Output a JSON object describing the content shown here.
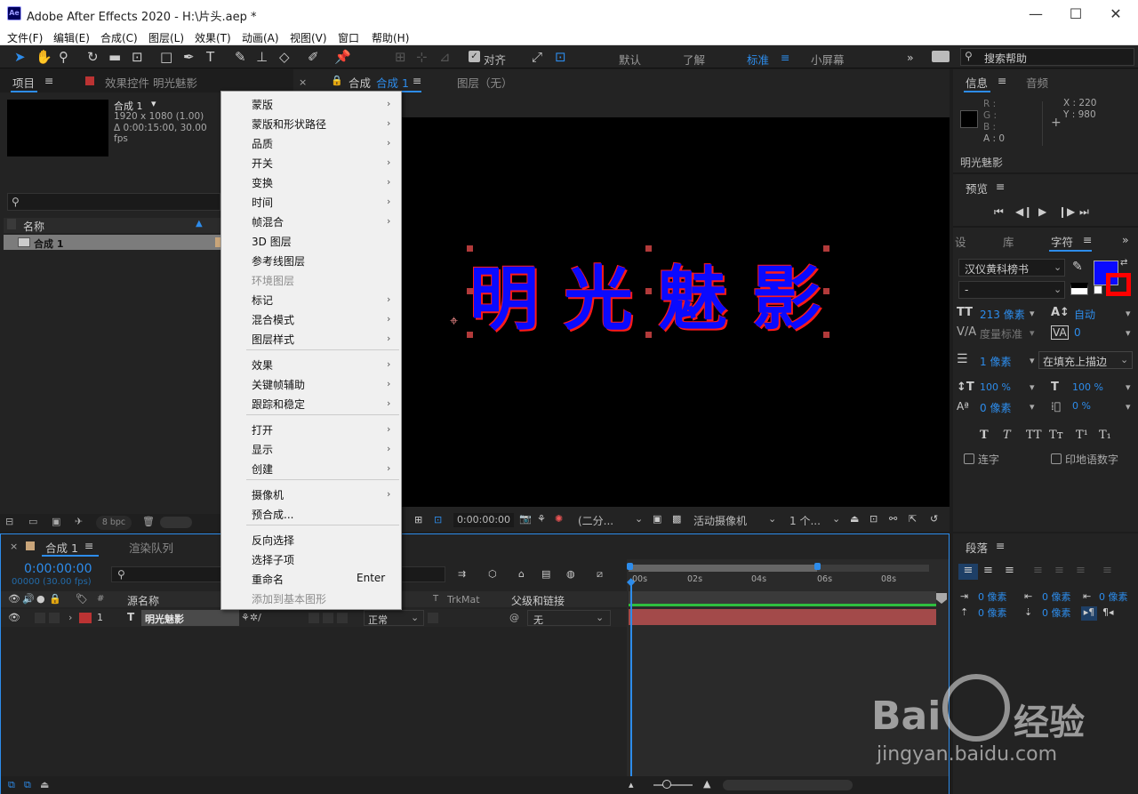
{
  "window": {
    "title": "Adobe After Effects 2020 - H:\\片头.aep *",
    "icon": "Ae"
  },
  "menu": [
    "文件(F)",
    "编辑(E)",
    "合成(C)",
    "图层(L)",
    "效果(T)",
    "动画(A)",
    "视图(V)",
    "窗口",
    "帮助(H)"
  ],
  "toolbar": {
    "align_label": "对齐",
    "workspaces": [
      "默认",
      "了解",
      "标准",
      "小屏幕"
    ],
    "active_workspace": "标准",
    "search_placeholder": "搜索帮助"
  },
  "project_panel": {
    "tab_project": "项目",
    "tab_effects": "效果控件 明光魅影",
    "comp_name": "合成 1",
    "comp_res": "1920 x 1080 (1.00)",
    "comp_dur": "Δ 0:00:15:00, 30.00 fps",
    "col_name": "名称",
    "item": "合成 1",
    "bpc": "8 bpc"
  },
  "comp_panel": {
    "tab_comp": "合成",
    "tab_comp_name": "合成 1",
    "tab_layer": "图层（无）",
    "text": "明光魅影",
    "timecode": "0:00:00:00",
    "resolution": "(二分...",
    "camera": "活动摄像机",
    "views": "1 个..."
  },
  "context_menu": [
    {
      "label": "蒙版",
      "arrow": true,
      "disabled": false
    },
    {
      "label": "蒙版和形状路径",
      "arrow": true,
      "disabled": false
    },
    {
      "label": "品质",
      "arrow": true,
      "disabled": false
    },
    {
      "label": "开关",
      "arrow": true,
      "disabled": false
    },
    {
      "label": "变换",
      "arrow": true,
      "disabled": false
    },
    {
      "label": "时间",
      "arrow": true,
      "disabled": false
    },
    {
      "label": "帧混合",
      "arrow": true,
      "disabled": false
    },
    {
      "label": "3D 图层",
      "arrow": false,
      "disabled": false
    },
    {
      "label": "参考线图层",
      "arrow": false,
      "disabled": false
    },
    {
      "label": "环境图层",
      "arrow": false,
      "disabled": true
    },
    {
      "label": "标记",
      "arrow": true,
      "disabled": false
    },
    {
      "label": "混合模式",
      "arrow": true,
      "disabled": false
    },
    {
      "label": "图层样式",
      "arrow": true,
      "disabled": false
    },
    {
      "label": "效果",
      "arrow": true,
      "disabled": false
    },
    {
      "label": "关键帧辅助",
      "arrow": true,
      "disabled": false
    },
    {
      "label": "跟踪和稳定",
      "arrow": true,
      "disabled": false
    },
    {
      "label": "打开",
      "arrow": true,
      "disabled": false
    },
    {
      "label": "显示",
      "arrow": true,
      "disabled": false
    },
    {
      "label": "创建",
      "arrow": true,
      "disabled": false
    },
    {
      "label": "摄像机",
      "arrow": true,
      "disabled": false
    },
    {
      "label": "预合成...",
      "arrow": false,
      "disabled": false
    },
    {
      "label": "反向选择",
      "arrow": false,
      "disabled": false
    },
    {
      "label": "选择子项",
      "arrow": false,
      "disabled": false
    },
    {
      "label": "重命名",
      "arrow": false,
      "disabled": false,
      "shortcut": "Enter"
    },
    {
      "label": "添加到基本图形",
      "arrow": false,
      "disabled": true
    }
  ],
  "info_panel": {
    "tab_info": "信息",
    "tab_audio": "音频",
    "r": "R :",
    "g": "G :",
    "b": "B :",
    "a": "A : 0",
    "x": "X : 220",
    "y": "Y : 980",
    "layer_name": "明光魅影"
  },
  "preview_panel": {
    "title": "预览"
  },
  "character_panel": {
    "tab_set": "设",
    "tab_lib": "库",
    "tab_char": "字符",
    "font": "汉仪黄科榜书",
    "style": "-",
    "size": "213 像素",
    "leading": "自动",
    "kerning": "度量标准",
    "tracking": "0",
    "stroke_width": "1 像素",
    "stroke_mode": "在填充上描边",
    "vscale": "100 %",
    "hscale": "100 %",
    "baseline": "0 像素",
    "tsume": "0 %",
    "ligature": "连字",
    "hindi": "印地语数字",
    "fill_color": "#0a0aff",
    "stroke_color": "#ff0000"
  },
  "paragraph_panel": {
    "title": "段落",
    "indent_left": "0 像素",
    "indent_first": "0 像素",
    "indent_right": "0 像素",
    "space_before": "0 像素",
    "space_after": "0 像素"
  },
  "timeline": {
    "tab_comp": "合成 1",
    "tab_render": "渲染队列",
    "timecode": "0:00:00:00",
    "frames": "00000 (30.00 fps)",
    "col_source": "源名称",
    "col_trkmat": "TrkMat",
    "col_parent": "父级和链接",
    "layer_num": "1",
    "layer_type": "T",
    "layer_name": "明光魅影",
    "blend_mode": "正常",
    "parent": "无",
    "ticks": [
      "00s",
      "02s",
      "04s",
      "06s",
      "08s"
    ]
  }
}
